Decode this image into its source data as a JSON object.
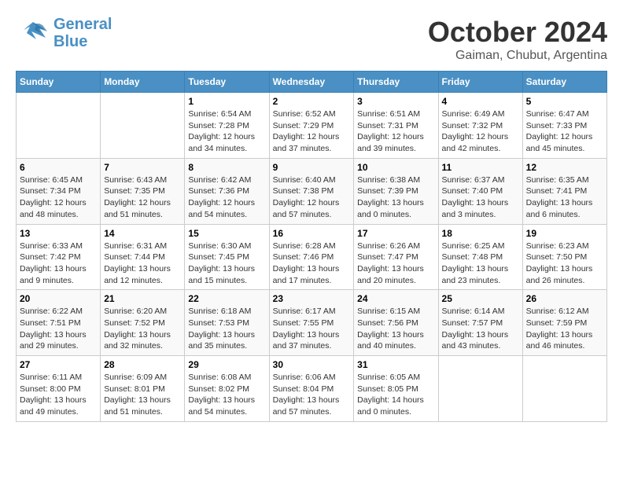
{
  "header": {
    "logo_line1": "General",
    "logo_line2": "Blue",
    "month": "October 2024",
    "location": "Gaiman, Chubut, Argentina"
  },
  "days_of_week": [
    "Sunday",
    "Monday",
    "Tuesday",
    "Wednesday",
    "Thursday",
    "Friday",
    "Saturday"
  ],
  "weeks": [
    [
      {
        "day": "",
        "info": ""
      },
      {
        "day": "",
        "info": ""
      },
      {
        "day": "1",
        "info": "Sunrise: 6:54 AM\nSunset: 7:28 PM\nDaylight: 12 hours and 34 minutes."
      },
      {
        "day": "2",
        "info": "Sunrise: 6:52 AM\nSunset: 7:29 PM\nDaylight: 12 hours and 37 minutes."
      },
      {
        "day": "3",
        "info": "Sunrise: 6:51 AM\nSunset: 7:31 PM\nDaylight: 12 hours and 39 minutes."
      },
      {
        "day": "4",
        "info": "Sunrise: 6:49 AM\nSunset: 7:32 PM\nDaylight: 12 hours and 42 minutes."
      },
      {
        "day": "5",
        "info": "Sunrise: 6:47 AM\nSunset: 7:33 PM\nDaylight: 12 hours and 45 minutes."
      }
    ],
    [
      {
        "day": "6",
        "info": "Sunrise: 6:45 AM\nSunset: 7:34 PM\nDaylight: 12 hours and 48 minutes."
      },
      {
        "day": "7",
        "info": "Sunrise: 6:43 AM\nSunset: 7:35 PM\nDaylight: 12 hours and 51 minutes."
      },
      {
        "day": "8",
        "info": "Sunrise: 6:42 AM\nSunset: 7:36 PM\nDaylight: 12 hours and 54 minutes."
      },
      {
        "day": "9",
        "info": "Sunrise: 6:40 AM\nSunset: 7:38 PM\nDaylight: 12 hours and 57 minutes."
      },
      {
        "day": "10",
        "info": "Sunrise: 6:38 AM\nSunset: 7:39 PM\nDaylight: 13 hours and 0 minutes."
      },
      {
        "day": "11",
        "info": "Sunrise: 6:37 AM\nSunset: 7:40 PM\nDaylight: 13 hours and 3 minutes."
      },
      {
        "day": "12",
        "info": "Sunrise: 6:35 AM\nSunset: 7:41 PM\nDaylight: 13 hours and 6 minutes."
      }
    ],
    [
      {
        "day": "13",
        "info": "Sunrise: 6:33 AM\nSunset: 7:42 PM\nDaylight: 13 hours and 9 minutes."
      },
      {
        "day": "14",
        "info": "Sunrise: 6:31 AM\nSunset: 7:44 PM\nDaylight: 13 hours and 12 minutes."
      },
      {
        "day": "15",
        "info": "Sunrise: 6:30 AM\nSunset: 7:45 PM\nDaylight: 13 hours and 15 minutes."
      },
      {
        "day": "16",
        "info": "Sunrise: 6:28 AM\nSunset: 7:46 PM\nDaylight: 13 hours and 17 minutes."
      },
      {
        "day": "17",
        "info": "Sunrise: 6:26 AM\nSunset: 7:47 PM\nDaylight: 13 hours and 20 minutes."
      },
      {
        "day": "18",
        "info": "Sunrise: 6:25 AM\nSunset: 7:48 PM\nDaylight: 13 hours and 23 minutes."
      },
      {
        "day": "19",
        "info": "Sunrise: 6:23 AM\nSunset: 7:50 PM\nDaylight: 13 hours and 26 minutes."
      }
    ],
    [
      {
        "day": "20",
        "info": "Sunrise: 6:22 AM\nSunset: 7:51 PM\nDaylight: 13 hours and 29 minutes."
      },
      {
        "day": "21",
        "info": "Sunrise: 6:20 AM\nSunset: 7:52 PM\nDaylight: 13 hours and 32 minutes."
      },
      {
        "day": "22",
        "info": "Sunrise: 6:18 AM\nSunset: 7:53 PM\nDaylight: 13 hours and 35 minutes."
      },
      {
        "day": "23",
        "info": "Sunrise: 6:17 AM\nSunset: 7:55 PM\nDaylight: 13 hours and 37 minutes."
      },
      {
        "day": "24",
        "info": "Sunrise: 6:15 AM\nSunset: 7:56 PM\nDaylight: 13 hours and 40 minutes."
      },
      {
        "day": "25",
        "info": "Sunrise: 6:14 AM\nSunset: 7:57 PM\nDaylight: 13 hours and 43 minutes."
      },
      {
        "day": "26",
        "info": "Sunrise: 6:12 AM\nSunset: 7:59 PM\nDaylight: 13 hours and 46 minutes."
      }
    ],
    [
      {
        "day": "27",
        "info": "Sunrise: 6:11 AM\nSunset: 8:00 PM\nDaylight: 13 hours and 49 minutes."
      },
      {
        "day": "28",
        "info": "Sunrise: 6:09 AM\nSunset: 8:01 PM\nDaylight: 13 hours and 51 minutes."
      },
      {
        "day": "29",
        "info": "Sunrise: 6:08 AM\nSunset: 8:02 PM\nDaylight: 13 hours and 54 minutes."
      },
      {
        "day": "30",
        "info": "Sunrise: 6:06 AM\nSunset: 8:04 PM\nDaylight: 13 hours and 57 minutes."
      },
      {
        "day": "31",
        "info": "Sunrise: 6:05 AM\nSunset: 8:05 PM\nDaylight: 14 hours and 0 minutes."
      },
      {
        "day": "",
        "info": ""
      },
      {
        "day": "",
        "info": ""
      }
    ]
  ]
}
